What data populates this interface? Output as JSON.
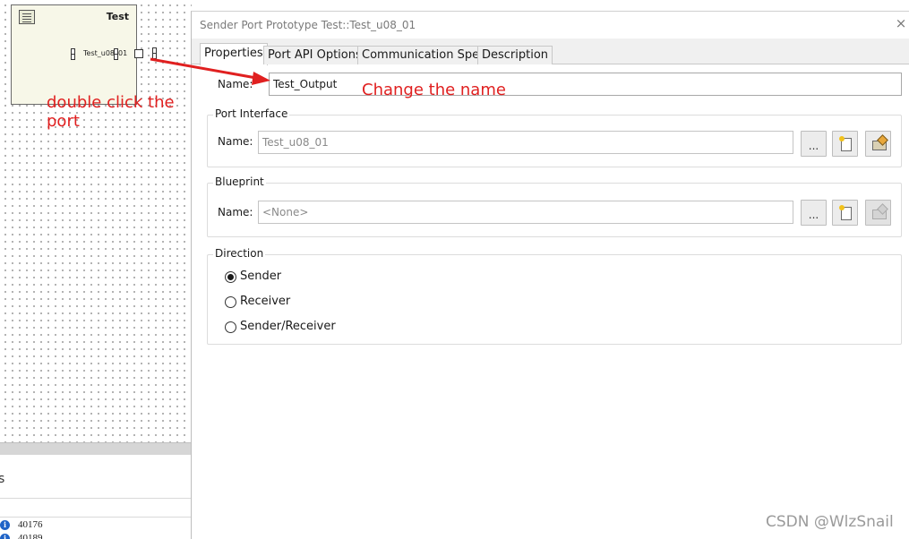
{
  "diagram": {
    "component_title": "Test",
    "port_label": "Test_u08_01"
  },
  "annotations": {
    "double_click": "double click the port",
    "change_name": "Change the name"
  },
  "lower_panel": {
    "title": "s",
    "messages": [
      {
        "icon": "info-icon",
        "text": "40176"
      },
      {
        "icon": "info-icon",
        "text": "40189"
      }
    ]
  },
  "dialog": {
    "title": "Sender Port Prototype Test::Test_u08_01",
    "close_glyph": "×",
    "tabs": [
      {
        "label": "Properties",
        "active": true
      },
      {
        "label": "Port API Options",
        "active": false
      },
      {
        "label": "Communication Spec",
        "active": false
      },
      {
        "label": "Description",
        "active": false
      }
    ],
    "name_label": "Name:",
    "name_value": "Test_Output",
    "port_interface": {
      "title": "Port Interface",
      "name_label": "Name:",
      "name_value": "Test_u08_01",
      "browse_label": "..."
    },
    "blueprint": {
      "title": "Blueprint",
      "name_label": "Name:",
      "name_value": "<None>",
      "browse_label": "..."
    },
    "direction": {
      "title": "Direction",
      "options": [
        {
          "label": "Sender",
          "checked": true
        },
        {
          "label": "Receiver",
          "checked": false
        },
        {
          "label": "Sender/Receiver",
          "checked": false
        }
      ]
    }
  },
  "watermark": "CSDN @WlzSnail",
  "colors": {
    "annotation_red": "#e02020",
    "canvas_dot": "#9a9a9a",
    "component_fill": "#f7f7e8"
  }
}
